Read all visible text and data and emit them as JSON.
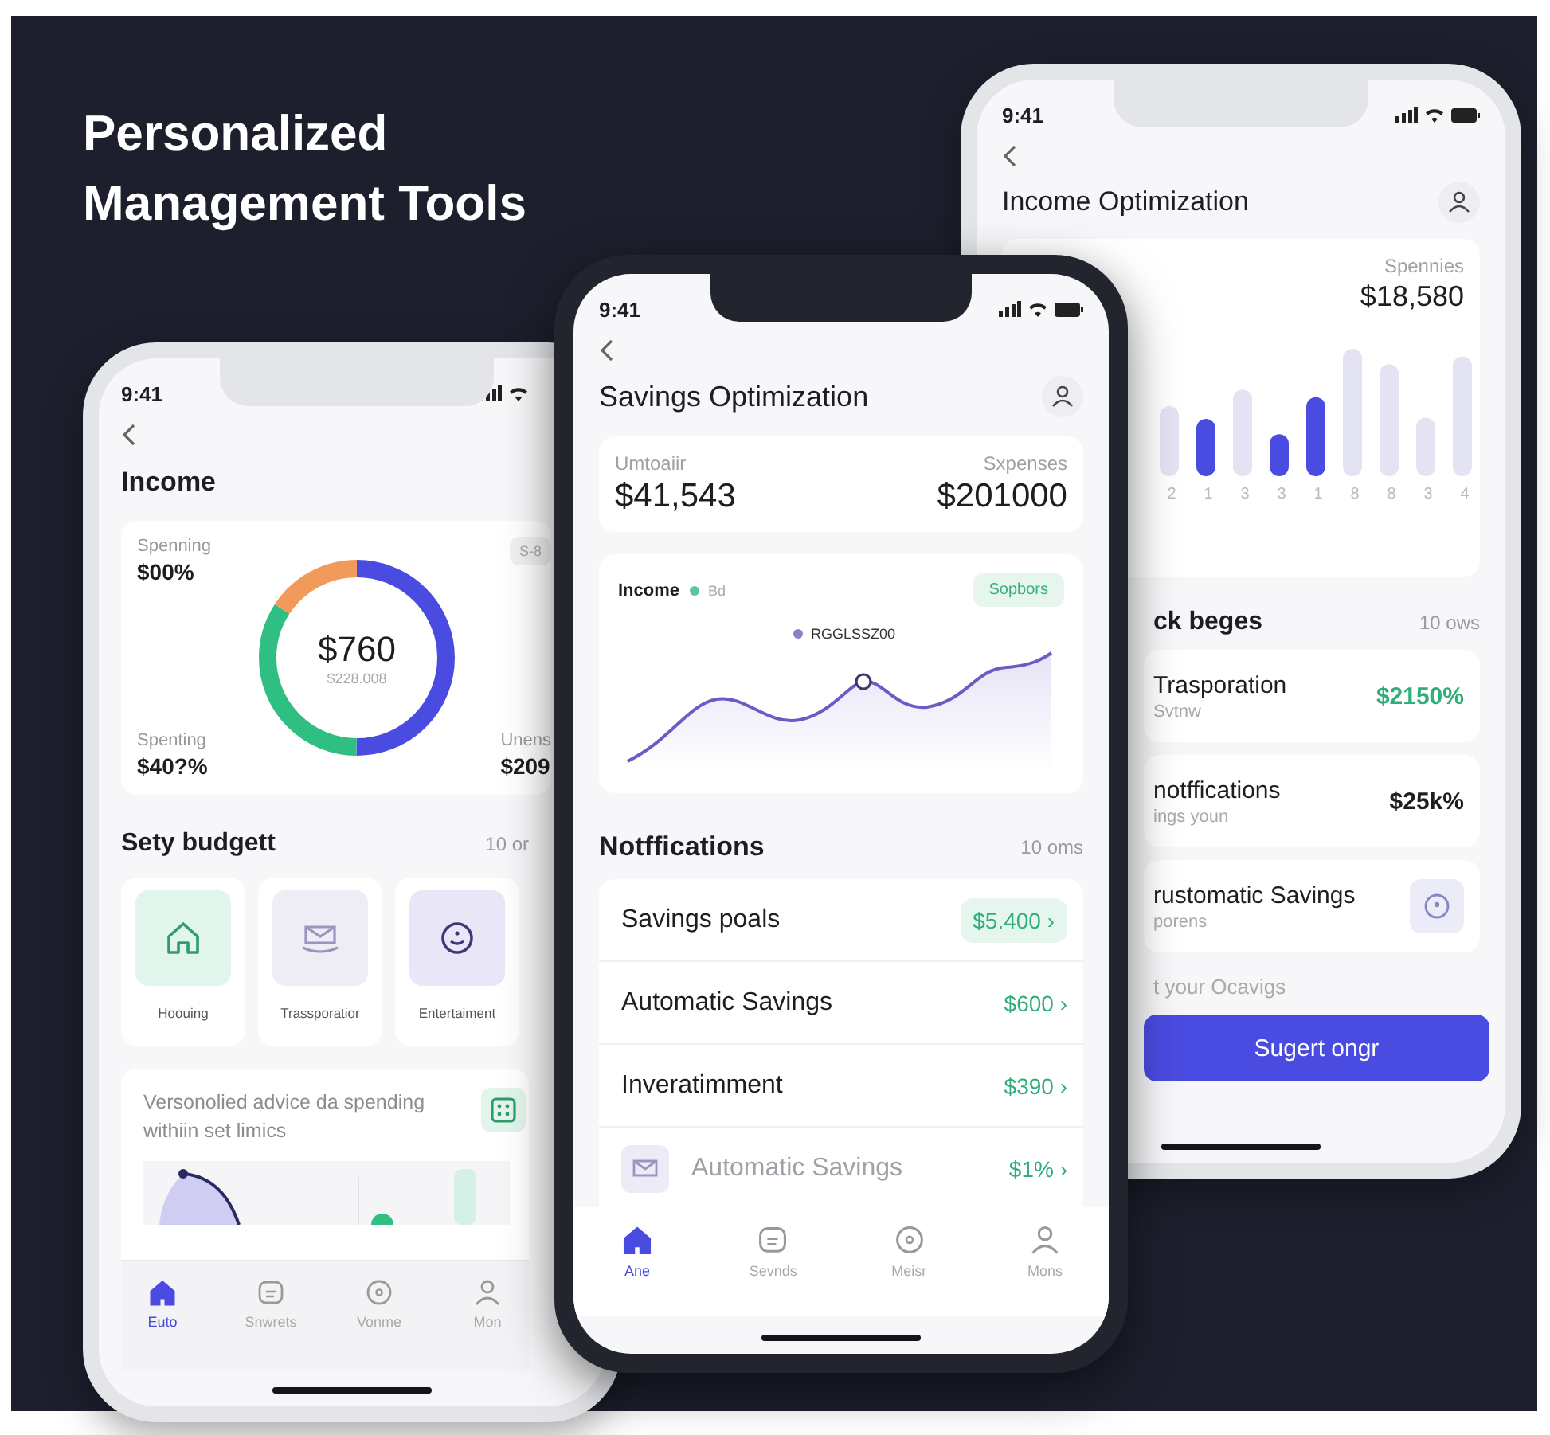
{
  "headline": "Personalized Management Tools",
  "left_phone": {
    "time": "9:41",
    "title": "Income",
    "summary": {
      "top_label": "Spenning",
      "top_value": "$00%",
      "center_value": "$760",
      "center_caption": "$228.008",
      "bottom_label": "Spenting",
      "bottom_value": "$40?%",
      "badge": "S-8",
      "right_label": "Unens",
      "right_value": "$209"
    },
    "budget_title": "Sety budgett",
    "budget_count": "10 or",
    "categories": [
      {
        "kind": "house",
        "label": "Hoouing"
      },
      {
        "kind": "mail",
        "label": "Trassporatior"
      },
      {
        "kind": "smiley",
        "label": "Entertaiment"
      }
    ],
    "advice": "Versonolied advice da spending withiin set limics",
    "nav": [
      {
        "kind": "home",
        "label": "Euto",
        "selected": true
      },
      {
        "kind": "chat",
        "label": "Snwrets",
        "selected": false
      },
      {
        "kind": "bubble",
        "label": "Vonme",
        "selected": false
      },
      {
        "kind": "person",
        "label": "Mon",
        "selected": false
      }
    ]
  },
  "center_phone": {
    "time": "9:41",
    "title": "Savings Optimization",
    "stats": [
      {
        "label": "Umtoaiir",
        "value": "$41,543"
      },
      {
        "label": "Sxpenses",
        "value": "$201000"
      }
    ],
    "chart": {
      "title": "Income",
      "legend": "Bd",
      "pill": "Sopbors",
      "point_label": "RGGLSSZ00"
    },
    "section_title": "Notffications",
    "section_count": "10 oms",
    "rows": [
      {
        "kind": "pill",
        "label": "Savings poals",
        "value": "$5.400 ›"
      },
      {
        "kind": "plain",
        "label": "Automatic Savings",
        "value": "$600 ›"
      },
      {
        "kind": "plain",
        "label": "Inveratimment",
        "value": "$390 ›"
      },
      {
        "kind": "muted",
        "label": "Automatic Savings",
        "value": "$1% ›"
      }
    ],
    "nav": [
      {
        "kind": "home",
        "label": "Ane",
        "selected": true
      },
      {
        "kind": "chat",
        "label": "Sevnds",
        "selected": false
      },
      {
        "kind": "bubble",
        "label": "Meisr",
        "selected": false
      },
      {
        "kind": "person",
        "label": "Mons",
        "selected": false
      }
    ]
  },
  "right_phone": {
    "time": "9:41",
    "title": "Income Optimization",
    "stat": {
      "label": "Spennies",
      "value": "$18,580"
    },
    "bar_labels": [
      "2",
      "1",
      "3",
      "3",
      "1",
      "8",
      "8",
      "3",
      "4"
    ],
    "section_title": "ck beges",
    "section_count": "10 ows",
    "rows": [
      {
        "kind": "gain",
        "title": "Trasporation",
        "subtitle": "Svtnw",
        "value": "$2150%"
      },
      {
        "kind": "plain",
        "title": "notffications",
        "subtitle": "ings youn",
        "value": "$25k%"
      },
      {
        "kind": "action",
        "title": "rustomatic Savings",
        "subtitle": "porens"
      }
    ],
    "hint": "t your Ocavigs",
    "button": "Sugert ongr"
  }
}
